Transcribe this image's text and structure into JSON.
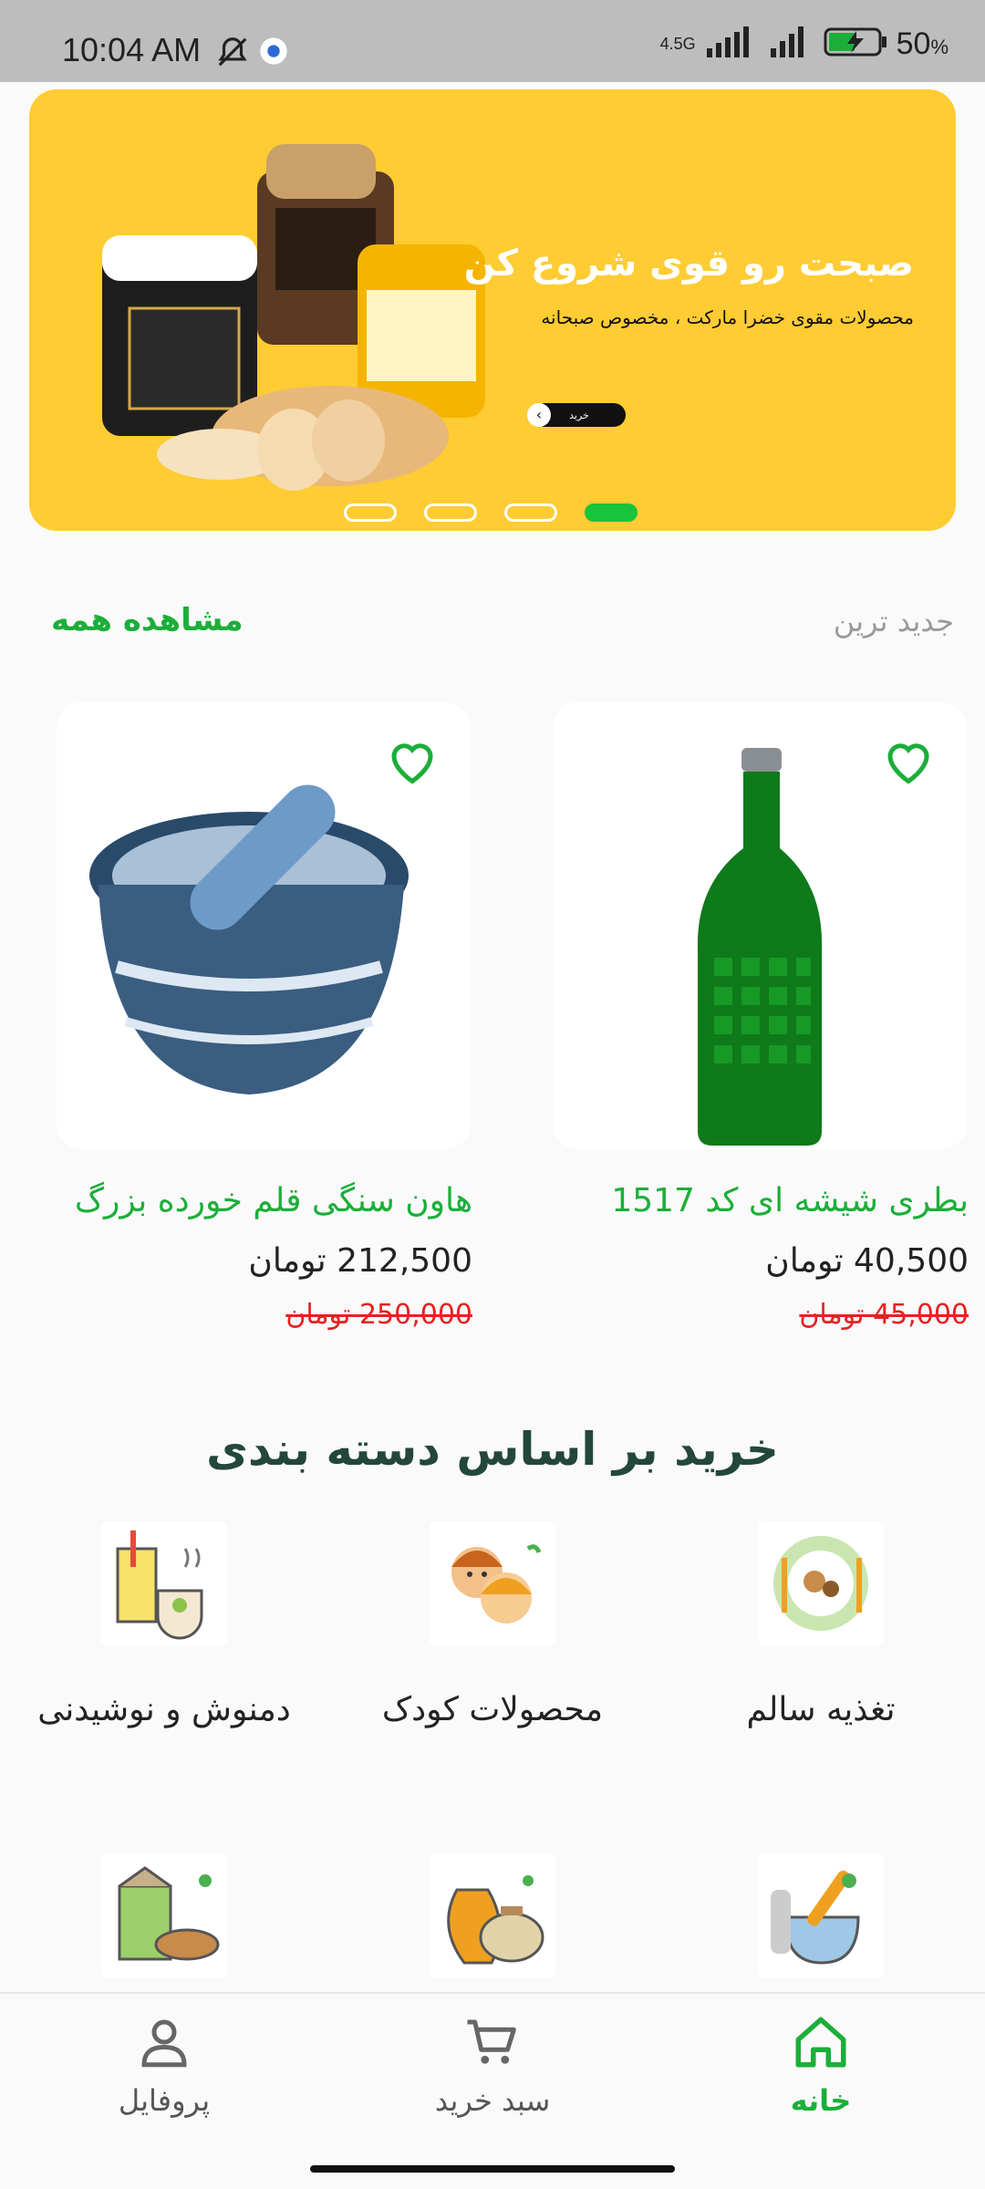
{
  "status_bar": {
    "time": "10:04 AM",
    "network": "4.5G",
    "battery": "50",
    "battery_unit": "%"
  },
  "banner": {
    "title": "صبحت رو قوی شروع کن",
    "subtitle": "محصولات مقوی خضرا مارکت ، مخصوص صبحانه",
    "button_label": "خرید",
    "slide_count": 4,
    "active_slide": 4,
    "background": "#ffcc33"
  },
  "section": {
    "title": "جدید ترین",
    "see_all": "مشاهده همه"
  },
  "products": [
    {
      "name": "بطری شیشه ای کد 1517",
      "price": "40,500 تومان",
      "old_price": "45,000 تومان",
      "image_icon": "green-glass-bottle-image"
    },
    {
      "name": "هاون سنگی قلم خورده بزرگ",
      "price": "212,500 تومان",
      "old_price": "250,000 تومان",
      "image_icon": "stone-mortar-image"
    }
  ],
  "categories": {
    "title": "خرید بر اساس دسته بندی",
    "items": [
      {
        "label": "تغذیه سالم",
        "icon": "healthy-food-icon"
      },
      {
        "label": "محصولات کودک",
        "icon": "kids-products-icon"
      },
      {
        "label": "دمنوش و نوشیدنی",
        "icon": "drinks-icon"
      },
      {
        "label": "",
        "icon": "mortar-pestle-icon"
      },
      {
        "label": "",
        "icon": "pottery-icon"
      },
      {
        "label": "",
        "icon": "spices-icon"
      }
    ]
  },
  "bottom_nav": {
    "home": "خانه",
    "cart": "سبد خرید",
    "profile": "پروفایل"
  },
  "colors": {
    "accent": "#1cae3a",
    "price_old": "#e52222",
    "title_dark": "#23473a"
  }
}
